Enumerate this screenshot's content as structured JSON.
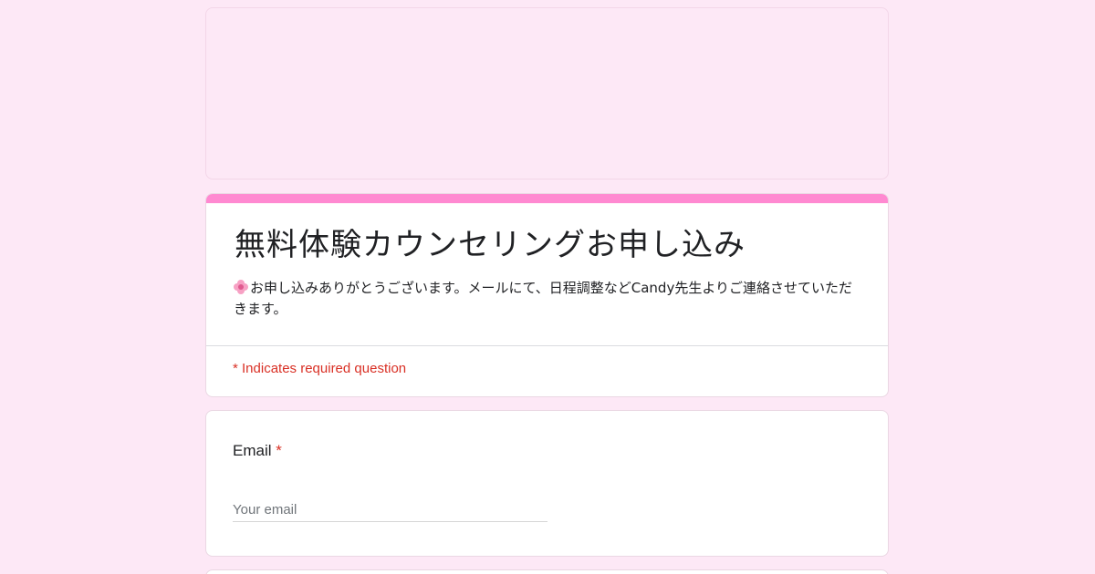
{
  "form": {
    "title": "無料体験カウンセリングお申し込み",
    "description": "お申し込みありがとうございます。メールにて、日程調整などCandy先生よりご連絡させていただきます。",
    "required_note": "* Indicates required question",
    "accent_color": "#ff89d1",
    "background_color": "#fde8f6",
    "description_icon": "cherry-blossom-icon"
  },
  "email_question": {
    "label": "Email",
    "required_mark": "*",
    "placeholder": "Your email",
    "value": ""
  }
}
